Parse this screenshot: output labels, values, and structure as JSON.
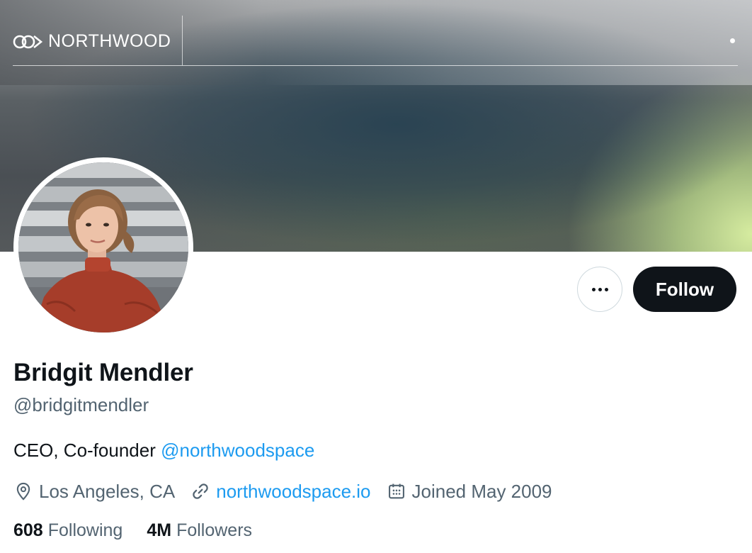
{
  "banner": {
    "brand_text": "NORTHWOOD"
  },
  "actions": {
    "more_label": "•••",
    "follow_label": "Follow"
  },
  "profile": {
    "display_name": "Bridgit Mendler",
    "handle": "@bridgitmendler",
    "bio_text": "CEO, Co-founder ",
    "bio_mention": "@northwoodspace",
    "location": "Los Angeles, CA",
    "website": "northwoodspace.io",
    "joined": "Joined May 2009"
  },
  "stats": {
    "following_count": "608",
    "following_label": "Following",
    "followers_count": "4M",
    "followers_label": "Followers"
  },
  "colors": {
    "accent_link": "#1d9bf0",
    "follow_button_bg": "#0f1419",
    "secondary_text": "#536471"
  },
  "icons": {
    "location": "location-pin-icon",
    "website": "link-icon",
    "joined": "calendar-icon",
    "more": "more-horizontal-icon",
    "brand": "northwood-logo-icon"
  }
}
